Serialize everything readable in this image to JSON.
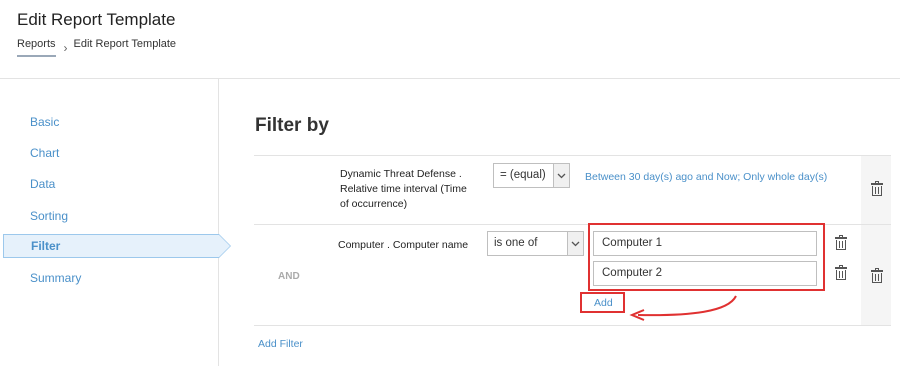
{
  "header": {
    "title": "Edit Report Template",
    "breadcrumb": {
      "root": "Reports",
      "current": "Edit Report Template"
    }
  },
  "sidebar": {
    "items": [
      {
        "label": "Basic"
      },
      {
        "label": "Chart"
      },
      {
        "label": "Data"
      },
      {
        "label": "Sorting"
      },
      {
        "label": "Filter",
        "active": true
      },
      {
        "label": "Summary"
      }
    ]
  },
  "main": {
    "section_title": "Filter by",
    "filters": [
      {
        "field": "Dynamic Threat Defense . Relative time interval (Time of occurrence)",
        "field_lines": [
          "Dynamic Threat Defense .",
          "Relative time interval (Time",
          "of occurrence)"
        ],
        "operator": "= (equal)",
        "value_text": "Between 30 day(s) ago and Now; Only whole day(s)"
      },
      {
        "connector": "AND",
        "field": "Computer . Computer name",
        "operator": "is one of",
        "values": [
          "Computer 1",
          "Computer 2"
        ],
        "add_label": "Add"
      }
    ],
    "add_filter_label": "Add Filter"
  },
  "colors": {
    "accent": "#4a90c9",
    "active_bg": "#e6f1fb",
    "highlight": "#e03131"
  },
  "icons": {
    "breadcrumb_separator": "chevron-right-icon",
    "dropdown": "chevron-down-icon",
    "delete": "trash-icon"
  }
}
